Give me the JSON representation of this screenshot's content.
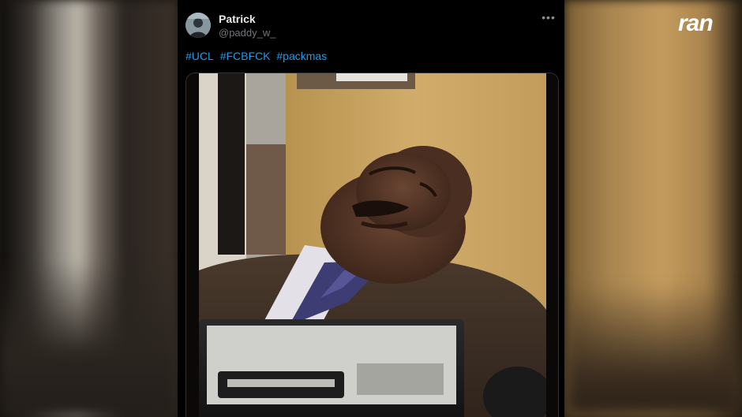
{
  "tweet": {
    "author_name": "Patrick",
    "author_handle": "@paddy_w_",
    "hashtags": [
      "#UCL",
      "#FCBFCK",
      "#packmas"
    ],
    "more_icon": "ellipsis-icon"
  },
  "media": {
    "type": "gif-still"
  },
  "brand": {
    "logo_text": "ran",
    "logo_color": "#ffffff"
  },
  "colors": {
    "tweet_background": "#000000",
    "hashtag_blue": "#1d9bf0",
    "handle_gray": "#71767b"
  }
}
